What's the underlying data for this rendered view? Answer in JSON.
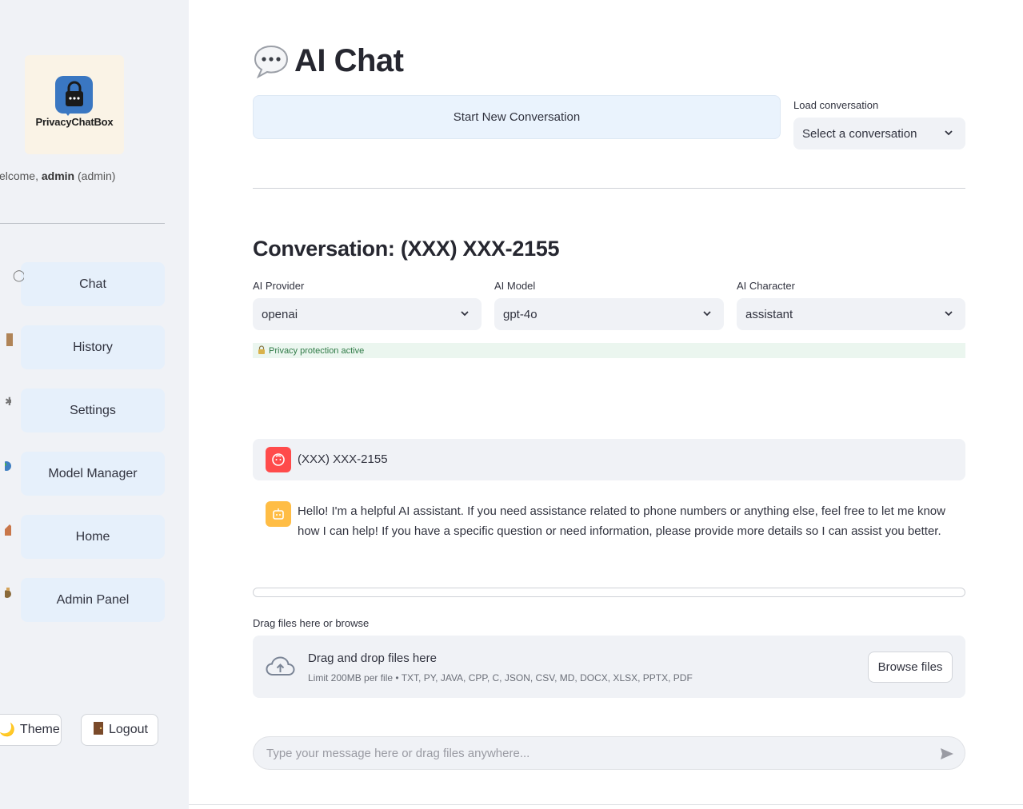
{
  "sidebar": {
    "logo_text": "PrivacyChatBox",
    "welcome_prefix": "Welcome, ",
    "welcome_user": "admin",
    "welcome_role": " (admin)",
    "nav": [
      {
        "label": "Chat",
        "icon": "speech-bubble-icon"
      },
      {
        "label": "History",
        "icon": "scroll-icon"
      },
      {
        "label": "Settings",
        "icon": "gear-icon"
      },
      {
        "label": "Model Manager",
        "icon": "globe-icon"
      },
      {
        "label": "Home",
        "icon": "house-icon"
      },
      {
        "label": "Admin Panel",
        "icon": "admin-icon"
      }
    ],
    "theme_label": "Theme",
    "logout_label": "Logout"
  },
  "main": {
    "title": "AI Chat",
    "new_conversation_label": "Start New Conversation",
    "load_conversation_label": "Load conversation",
    "load_conversation_value": "Select a conversation",
    "conversation_title": "Conversation: (XXX) XXX-2155",
    "provider_label": "AI Provider",
    "provider_value": "openai",
    "model_label": "AI Model",
    "model_value": "gpt-4o",
    "character_label": "AI Character",
    "character_value": "assistant",
    "privacy_text": "Privacy protection active",
    "messages": [
      {
        "role": "user",
        "text": "(XXX) XXX-2155"
      },
      {
        "role": "assistant",
        "line1": "Hello! I'm a helpful AI assistant. If you need assistance related to phone numbers or anything else, feel free to let me know",
        "line2": "how I can help! If you have a specific question or need information, please provide more details so I can assist you better."
      }
    ],
    "upload_label": "Drag files here or browse",
    "dropzone_title": "Drag and drop files here",
    "dropzone_limit": "Limit 200MB per file • TXT, PY, JAVA, CPP, C, JSON, CSV, MD, DOCX, XLSX, PPTX, PDF",
    "browse_label": "Browse files",
    "chat_placeholder": "Type your message here or drag files anywhere..."
  },
  "colors": {
    "sidebar_bg": "#f0f2f6",
    "nav_button_bg": "#e6f0fb",
    "user_avatar": "#ff4b4b",
    "assistant_avatar": "#ffbd45",
    "privacy_bg": "#ebf6ef",
    "privacy_text": "#2f7a46"
  }
}
